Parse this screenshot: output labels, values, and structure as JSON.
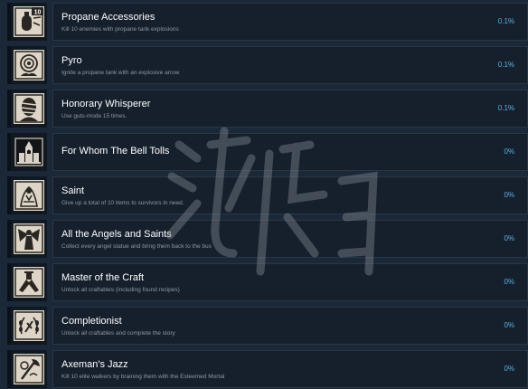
{
  "colors": {
    "background": "#1b2838",
    "row": "#16202d",
    "title": "#ffffff",
    "description": "#8f98a0",
    "percent": "#57b1e0",
    "icon_art": "#d8d2c4"
  },
  "achievements": [
    {
      "icon": "propane-icon",
      "badge": "10",
      "title": "Propane Accessories",
      "description": "Kill 10 enemies with propane tank explosions",
      "percent": "0.1%"
    },
    {
      "icon": "fire-target-icon",
      "title": "Pyro",
      "description": "Ignite a propane tank with an explosive arrow",
      "percent": "0.1%"
    },
    {
      "icon": "bandaged-head-icon",
      "title": "Honorary Whisperer",
      "description": "Use guts-mode 15 times.",
      "percent": "0.1%"
    },
    {
      "icon": "bell-tower-icon",
      "title": "For Whom The Bell Tolls",
      "description": "",
      "percent": "0%"
    },
    {
      "icon": "praying-figure-icon",
      "title": "Saint",
      "description": "Give up a total of 10 items to survivors in need.",
      "percent": "0%"
    },
    {
      "icon": "angel-statue-icon",
      "title": "All the Angels and Saints",
      "description": "Collect every angel statue and bring them back to the bus",
      "percent": "0%"
    },
    {
      "icon": "crafting-hands-icon",
      "title": "Master of the Craft",
      "description": "Unlock all craftables (including found recipes)",
      "percent": "0%"
    },
    {
      "icon": "laurel-wreath-icon",
      "title": "Completionist",
      "description": "Unlock all craftables and complete the story",
      "percent": "0%"
    },
    {
      "icon": "axe-icon",
      "title": "Axeman's Jazz",
      "description": "Kill 10 elite walkers by braining them with the Esteemed Mortal",
      "percent": "0%"
    }
  ]
}
